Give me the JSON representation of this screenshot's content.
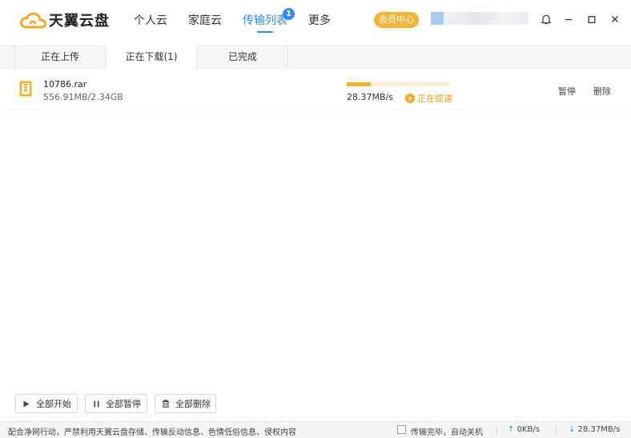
{
  "app": {
    "name": "天翼云盘",
    "brand_color": "#f5a623",
    "accent_color": "#2c8cf0"
  },
  "nav": {
    "items": [
      {
        "label": "个人云"
      },
      {
        "label": "家庭云"
      },
      {
        "label": "传输列表",
        "badge": "1",
        "active": true
      },
      {
        "label": "更多"
      }
    ]
  },
  "header": {
    "member_label": "会员中心"
  },
  "tabs": [
    {
      "label": "正在上传"
    },
    {
      "label": "正在下载(1)",
      "active": true
    },
    {
      "label": "已完成"
    }
  ],
  "downloads": [
    {
      "name": "10786.rar",
      "size": "556.91MB/2.34GB",
      "progress": 0.232,
      "speed": "28.37MB/s",
      "status": "正在提速",
      "pause_label": "暂停",
      "delete_label": "删除"
    }
  ],
  "actions": {
    "start_all": "全部开始",
    "pause_all": "全部暂停",
    "delete_all": "全部删除"
  },
  "statusbar": {
    "notice": "配合净网行动，严禁利用天翼云盘存储、传输反动信息、色情低俗信息、侵权内容",
    "auto_shutdown": "传输完毕，自动关机",
    "upload_speed": "0KB/s",
    "download_speed": "28.37MB/s"
  }
}
